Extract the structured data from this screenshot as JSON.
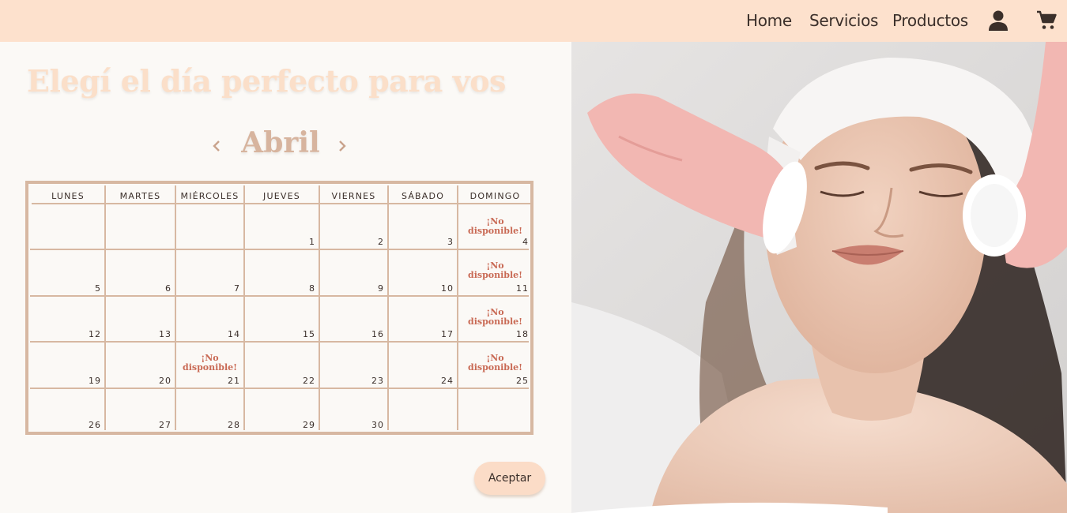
{
  "nav": {
    "links": [
      "Home",
      "Servicios",
      "Productos"
    ],
    "icons": [
      "user-icon",
      "cart-icon"
    ]
  },
  "booking": {
    "title": "Elegí el día perfecto para vos",
    "month": "Abril",
    "weekdays": [
      "LUNES",
      "MARTES",
      "MIÉRCOLES",
      "JUEVES",
      "VIERNES",
      "SÁBADO",
      "DOMINGO"
    ],
    "weeks": [
      [
        "",
        "",
        "",
        "1",
        "2",
        "3",
        "4"
      ],
      [
        "5",
        "6",
        "7",
        "8",
        "9",
        "10",
        "11"
      ],
      [
        "12",
        "13",
        "14",
        "15",
        "16",
        "17",
        "18"
      ],
      [
        "19",
        "20",
        "21",
        "22",
        "23",
        "24",
        "25"
      ],
      [
        "26",
        "27",
        "28",
        "29",
        "30",
        "",
        ""
      ]
    ],
    "unavailable_days": [
      "4",
      "11",
      "18",
      "21",
      "25"
    ],
    "unavailable_text_1": "¡No",
    "unavailable_text_2": "disponible!",
    "accept_label": "Aceptar"
  },
  "colors": {
    "topbar": "#fde1cd",
    "title": "#fbdfc9",
    "month": "#d7b49e",
    "grid": "#d7b8a2",
    "unavailable": "#c96a55"
  },
  "hero_image": "spa-facial-treatment-photo"
}
